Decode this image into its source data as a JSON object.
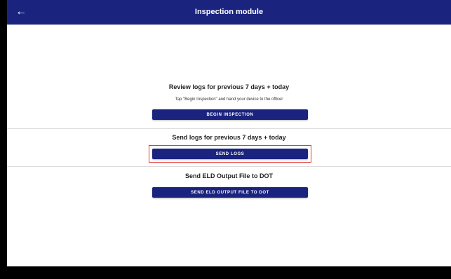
{
  "appbar": {
    "title": "Inspection module",
    "back_icon": "arrow-left-icon",
    "background": "#1a237e"
  },
  "review_section": {
    "title": "Review logs for previous 7 days + today",
    "subtitle": "Tap \"Begin Inspection\" and hand your device to the officer",
    "button_label": "BEGIN INSPECTION"
  },
  "send_section": {
    "title": "Send logs for previous 7 days + today",
    "button_label": "SEND LOGS",
    "highlight_color": "#e53935"
  },
  "eld_section": {
    "title": "Send ELD Output File to DOT",
    "button_label": "SEND ELD OUTPUT FILE TO DOT"
  }
}
